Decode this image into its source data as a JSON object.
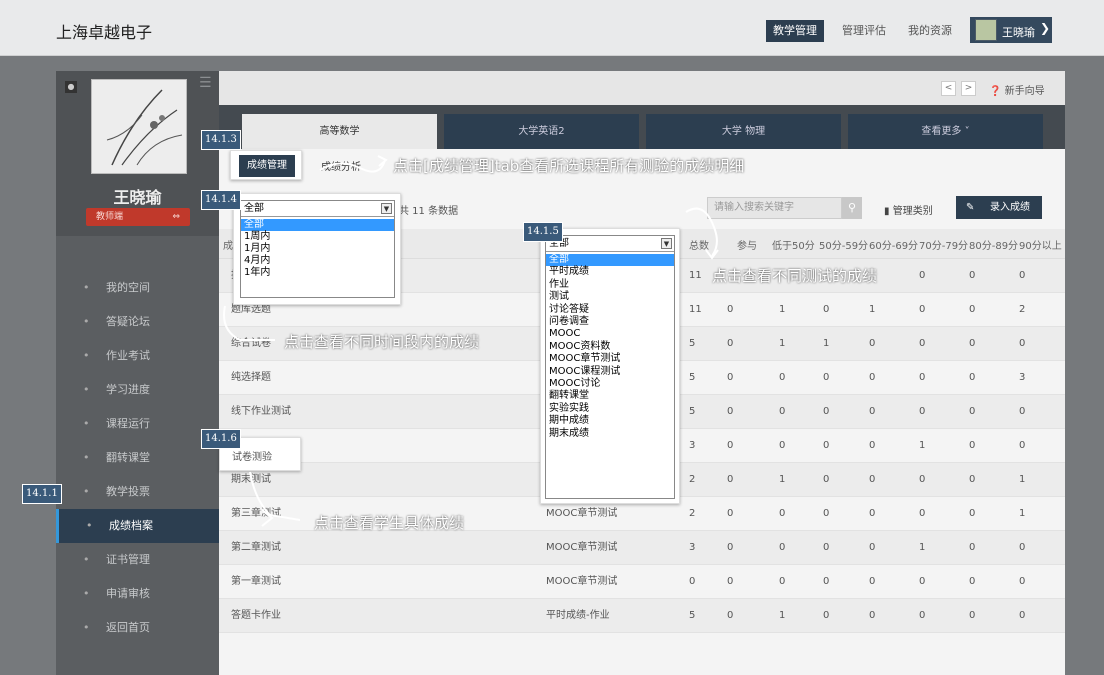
{
  "header": {
    "brand": "上海卓越电子",
    "nav": [
      "教学管理",
      "管理评估",
      "我的资源"
    ],
    "user_name": "王晓瑜"
  },
  "sidebar": {
    "user_name": "王晓瑜",
    "role": "教师端",
    "items": [
      {
        "label": "我的空间"
      },
      {
        "label": "答疑论坛"
      },
      {
        "label": "作业考试"
      },
      {
        "label": "学习进度"
      },
      {
        "label": "课程运行"
      },
      {
        "label": "翻转课堂"
      },
      {
        "label": "教学投票"
      },
      {
        "label": "成绩档案"
      },
      {
        "label": "证书管理"
      },
      {
        "label": "申请审核"
      },
      {
        "label": "返回首页"
      }
    ]
  },
  "main": {
    "newbie": "新手向导",
    "course_tabs": [
      "高等数学",
      "大学英语2",
      "大学 物理",
      "查看更多"
    ],
    "subtabs": [
      "成绩管理",
      "成绩分析"
    ],
    "count_text": "共 11 条数据",
    "search_placeholder": "请输入搜索关键字",
    "manage_label": "管理类别",
    "enter_label": "录入成绩",
    "columns": [
      "总数",
      "参与",
      "低于50分",
      "50分-59分",
      "60分-69分",
      "70分-79分",
      "80分-89分",
      "90分以上"
    ],
    "rows": [
      {
        "name": "指",
        "type": "",
        "vals": [
          "11",
          "",
          "",
          "",
          "",
          "0",
          "0",
          "0"
        ]
      },
      {
        "name": "题库选题",
        "type": "",
        "vals": [
          "11",
          "0",
          "1",
          "0",
          "1",
          "0",
          "0",
          "2"
        ]
      },
      {
        "name": "综合试卷",
        "type": "",
        "vals": [
          "5",
          "0",
          "1",
          "1",
          "0",
          "0",
          "0",
          "0"
        ]
      },
      {
        "name": "纯选择题",
        "type": "",
        "vals": [
          "5",
          "0",
          "0",
          "0",
          "0",
          "0",
          "0",
          "3"
        ]
      },
      {
        "name": "线下作业测试",
        "type": "",
        "vals": [
          "5",
          "0",
          "0",
          "0",
          "0",
          "0",
          "0",
          "0"
        ]
      },
      {
        "name": "试卷测验",
        "type": "",
        "vals": [
          "3",
          "0",
          "0",
          "0",
          "0",
          "1",
          "0",
          "0"
        ]
      },
      {
        "name": "期末测试",
        "type": "",
        "vals": [
          "2",
          "0",
          "1",
          "0",
          "0",
          "0",
          "0",
          "1"
        ]
      },
      {
        "name": "第三章测试",
        "type": "MOOC章节测试",
        "vals": [
          "2",
          "0",
          "0",
          "0",
          "0",
          "0",
          "0",
          "1"
        ]
      },
      {
        "name": "第二章测试",
        "type": "MOOC章节测试",
        "vals": [
          "3",
          "0",
          "0",
          "0",
          "0",
          "1",
          "0",
          "0"
        ]
      },
      {
        "name": "第一章测试",
        "type": "MOOC章节测试",
        "vals": [
          "0",
          "0",
          "0",
          "0",
          "0",
          "0",
          "0",
          "0"
        ]
      },
      {
        "name": "答题卡作业",
        "type": "平时成绩-作业",
        "vals": [
          "5",
          "0",
          "1",
          "0",
          "0",
          "0",
          "0",
          "0"
        ]
      }
    ],
    "time_select": {
      "value": "全部",
      "options": [
        "全部",
        "1周内",
        "1月内",
        "4月内",
        "1年内"
      ]
    },
    "type_select": {
      "value": "全部",
      "options": [
        "全部",
        "平时成绩",
        "作业",
        "测试",
        "讨论答疑",
        "问卷调查",
        "MOOC",
        "MOOC资料数",
        "MOOC章节测试",
        "MOOC课程测试",
        "MOOC讨论",
        "翻转课堂",
        "实验实践",
        "期中成绩",
        "期末成绩"
      ]
    }
  },
  "annotations": {
    "tag_1_1": "14.1.1",
    "tag_1_3": "14.1.3",
    "tag_1_4": "14.1.4",
    "tag_1_5": "14.1.5",
    "tag_1_6": "14.1.6",
    "note_tab": "点击[成绩管理]tab查看所选课程所有测验的成绩明细",
    "note_time": "点击查看不同时间段内的成绩",
    "note_test": "点击查看不同测试的成绩",
    "note_student": "点击查看学生具体成绩"
  }
}
